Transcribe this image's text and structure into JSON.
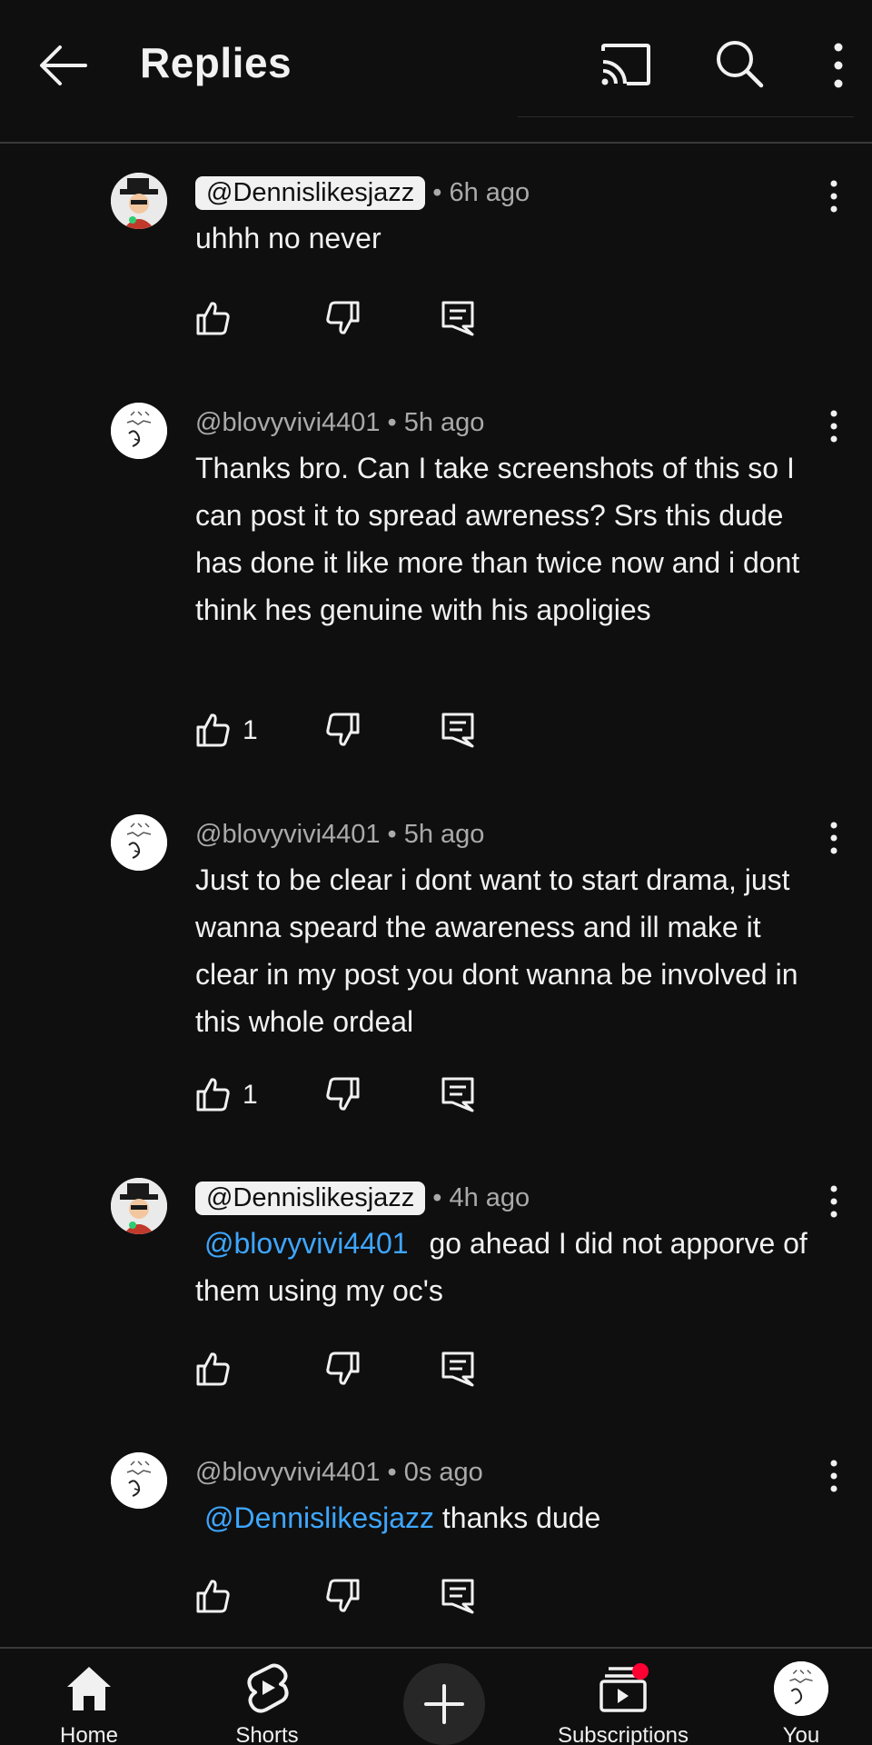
{
  "header": {
    "title": "Replies",
    "back_icon": "arrow-left-icon",
    "cast_icon": "cast-icon",
    "search_icon": "search-icon",
    "more_icon": "more-vertical-icon"
  },
  "comments": [
    {
      "handle": "@Dennislikesjazz",
      "is_owner": true,
      "time": "6h ago",
      "text_mention": "",
      "text": "uhhh no never",
      "likes": ""
    },
    {
      "handle": "@blovyvivi4401",
      "is_owner": false,
      "time": "5h ago",
      "text_mention": "",
      "text": "Thanks bro. Can I take screenshots of this so I can post it to spread awreness? Srs this dude has done it like more than twice now and i dont think hes genuine with his apoligies",
      "likes": "1"
    },
    {
      "handle": "@blovyvivi4401",
      "is_owner": false,
      "time": "5h ago",
      "text_mention": "",
      "text": "Just to be clear i dont want to start drama, just wanna speard the awareness and ill make it clear in my post you dont wanna be involved in this whole ordeal",
      "likes": "1"
    },
    {
      "handle": "@Dennislikesjazz",
      "is_owner": true,
      "time": "4h ago",
      "text_mention": "@blovyvivi4401",
      "text": "go ahead I did not apporve of them using my oc's",
      "likes": ""
    },
    {
      "handle": "@blovyvivi4401",
      "is_owner": false,
      "time": "0s ago",
      "text_mention": "@Dennislikesjazz",
      "text": "thanks dude",
      "likes": ""
    }
  ],
  "bottom_nav": {
    "home": "Home",
    "shorts": "Shorts",
    "create_icon": "plus-icon",
    "subscriptions": "Subscriptions",
    "you": "You"
  },
  "colors": {
    "background": "#0f0f0f",
    "text": "#f1f1f1",
    "secondary_text": "#aaaaaa",
    "mention": "#3ea6ff",
    "notification": "#ff0033"
  }
}
